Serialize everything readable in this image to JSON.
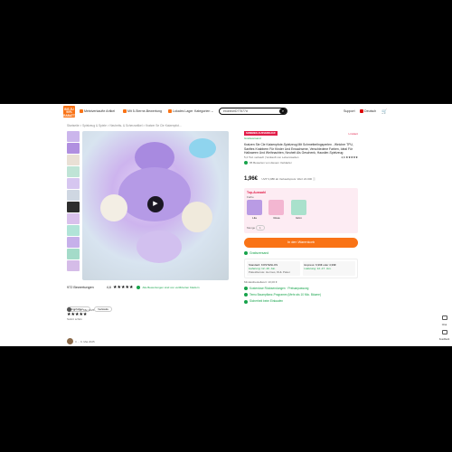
{
  "header": {
    "logo_text": "BIS ZU 90% RABATT",
    "nav": [
      {
        "icon": "thumbs-up-icon",
        "label": "Meistverkaufte Artikel"
      },
      {
        "icon": "star-icon",
        "label": "Mit 5-Sterne-Bewertung"
      },
      {
        "icon": "warehouse-icon",
        "label": "Lokales Lager"
      },
      {
        "icon": "none",
        "label": "Kategorien ⌄"
      }
    ],
    "search_value": "exoneoriD77577d",
    "right_links": [
      "Support",
      "Deutsch"
    ]
  },
  "breadcrumb": "Startseite  >  Spielzeug & Spiele  >  Neuheits- & Scherzartikel  >  Kratzer Se Cle Katzenpfot...",
  "reviews": {
    "count_label": "972 Bewertungen",
    "rating": "4,6",
    "stars": "★★★★★",
    "verified": "Alle Bewertungen sind von verifizierten Käufern",
    "filters": [
      "Empfohlen ⌄",
      "Verkäufe"
    ],
    "first": {
      "user": "K ... 11. Mai 2025",
      "stars": "★★★★★",
      "text": "Sofort schön"
    },
    "second": {
      "user": "Ir ... 9. Mai 2025"
    }
  },
  "product": {
    "badge": "SOMMER-AUSVERKAUF",
    "tag": "Gratisversand",
    "sale_tag": "Limitiert",
    "title": "Kratzen Sie Cle Katzenpfote-Spielzeug Mit Schmetterlingsperlen - Weicher TPU, Sanftes Knabbern Für Kinder Und Erwachsene, Verschiedene Farben, Ideal Für Halloween Und Weihnachten, Neuheit Als Geschenk, Haustier-Spielzeug",
    "sold": "5,2 Tsd. verkauft  |  Verkauft von Lebenswelten",
    "rating_right": "4,6 ★★★★★",
    "seller_tag": "95 Bewerten  von diesem Verkäufer",
    "price": "1,96€",
    "price_note": "UVP 3,98€ ab Verkaufspreis: Wert 24.000 ⓘ",
    "top_label": "Top-Auswahl",
    "options_label": "Farbe",
    "options": [
      {
        "name": "Lila",
        "color": "#b99be4"
      },
      {
        "name": "Rosa",
        "color": "#f3b6d1"
      },
      {
        "name": "Grün",
        "color": "#a9e1cc"
      }
    ],
    "qty_label": "Menge",
    "qty_value": "1",
    "cart_label": "In den Warenkorb"
  },
  "shipping": {
    "title": "Gratisversand",
    "standard": "Standard: KOSTENLOS",
    "standard_dates": "Lieferung: 12.-19. Jun.",
    "express": "Express: 6,99€ oder 4,99€",
    "express_dates": "Lieferung: 12.-17. Jun.",
    "partners": "Paketdienste: Hermes, DHL Paket",
    "guarantee": "Mindestbestellwert: 10,00 €",
    "returns": "Kostenlose Rücksendungen · Preisanpassung",
    "program": "Temu Baumpflanz-Programm (Mehr als 10 Mio. Bäume)",
    "safety": "Sicherheit beim Einkaufen"
  },
  "side_tools": [
    "Chat",
    "Feedback"
  ],
  "colors": {
    "accent": "#f97316",
    "brand_green": "#16a34a",
    "sale_red": "#e11d48"
  }
}
